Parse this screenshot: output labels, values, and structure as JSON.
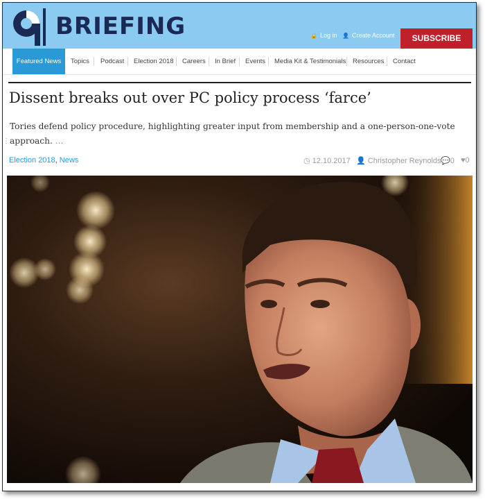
{
  "header": {
    "brand": "BRIEFING",
    "login_label": "Log in",
    "create_account_label": "Create Account",
    "subscribe_label": "SUBSCRIBE",
    "background_color": "#8ccbf1",
    "brand_color": "#1b2a55",
    "subscribe_color": "#c0202c"
  },
  "nav": {
    "items": [
      "Featured News",
      "Topics",
      "Podcast",
      "Election 2018",
      "Careers",
      "In Brief",
      "Events",
      "Media Kit & Testimonials",
      "Resources",
      "Contact"
    ],
    "active_index": 0,
    "active_color": "#2a9ad6"
  },
  "article": {
    "headline": "Dissent breaks out over PC policy process ‘farce’",
    "excerpt": "Tories defend policy procedure, highlighting greater input from membership and a one-person-one-vote approach.",
    "read_more": "...",
    "categories": [
      "Election 2018",
      "News"
    ],
    "category_separator": ",",
    "date": "12.10.2017",
    "author": "Christopher Reynolds",
    "comments_count": "0",
    "likes_count": "0",
    "link_color": "#2a9ad6"
  },
  "icons": {
    "login": "lock-icon",
    "create_account": "user-icon",
    "date": "clock-icon",
    "author": "user-icon",
    "comments": "comment-icon",
    "likes": "heart-icon"
  }
}
